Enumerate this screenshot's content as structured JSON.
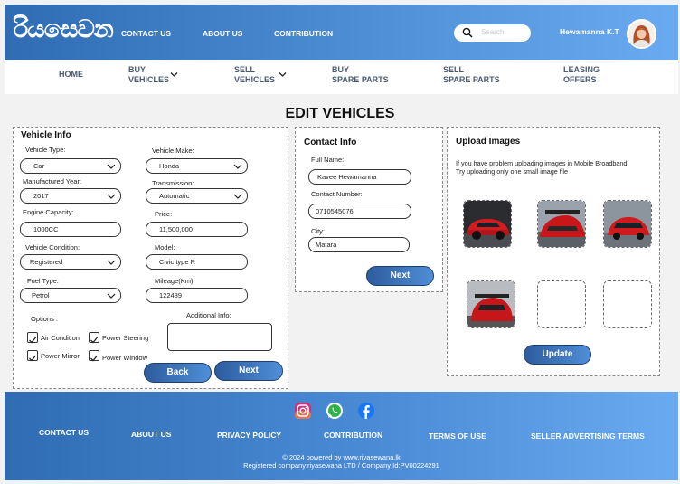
{
  "header": {
    "logo_text": "රියසෙවන",
    "nav": [
      "CONTACT US",
      "ABOUT US",
      "CONTRIBUTION"
    ],
    "search_placeholder": "Search",
    "username": "Hewamanna K.T"
  },
  "subnav": {
    "home": "HOME",
    "buy_vehicles": [
      "BUY",
      "VEHICLES"
    ],
    "sell_vehicles": [
      "SELL",
      "VEHICLES"
    ],
    "buy_spare": [
      "BUY",
      "SPARE PARTS"
    ],
    "sell_spare": [
      "SELL",
      "SPARE PARTS"
    ],
    "leasing": [
      "LEASING",
      "OFFERS"
    ]
  },
  "page_title": "EDIT VEHICLES",
  "vehicle_info": {
    "title": "Vehicle Info",
    "vehicle_type": {
      "label": "Vehicle Type:",
      "value": "Car"
    },
    "vehicle_make": {
      "label": "Vehicle Make:",
      "value": "Honda"
    },
    "manufactured_year": {
      "label": "Manufactured Year:",
      "value": "2017"
    },
    "transmission": {
      "label": "Transmission:",
      "value": "Automatic"
    },
    "engine_capacity": {
      "label": "Engine Capacity:",
      "value": "1000CC"
    },
    "price": {
      "label": "Price:",
      "value": "11,500,000"
    },
    "vehicle_condition": {
      "label": "Vehicle Condition:",
      "value": "Registered"
    },
    "model": {
      "label": "Model:",
      "value": "Civic type R"
    },
    "fuel_type": {
      "label": "Fuel Type:",
      "value": "Petrol"
    },
    "mileage": {
      "label": "Mileage(Km):",
      "value": "122489"
    },
    "options_label": "Options :",
    "options": {
      "air_condition": "Air Condition",
      "power_steering": "Power Steering",
      "power_mirror": "Power Mirror",
      "power_window": "Power Window"
    },
    "additional_label": "Additional Info:",
    "additional_value": "",
    "back": "Back",
    "next": "Next"
  },
  "contact_info": {
    "title": "Contact Info",
    "full_name": {
      "label": "Full Name:",
      "value": "Kavee Hewamanna"
    },
    "contact_number": {
      "label": "Contact Number:",
      "value": "0710545076"
    },
    "city": {
      "label": "City:",
      "value": "Matara"
    },
    "next": "Next"
  },
  "upload": {
    "title": "Upload Images",
    "note1": "If you have problem uploading images in Mobile Broadband,",
    "note2": "Try uploading only one small image file",
    "update": "Update"
  },
  "footer": {
    "links": [
      "CONTACT US",
      "ABOUT US",
      "PRIVACY POLICY",
      "CONTRIBUTION",
      "TERMS OF USE",
      "SELLER ADVERTISING TERMS"
    ],
    "copyright": "© 2024 powered by www.riyasewana.lk",
    "registered": "Registered company:riyasewana LTD / Company Id:PV00224291"
  },
  "colors": {
    "brand_dark": "#2f6cb3",
    "brand_light": "#6aaaf0"
  }
}
